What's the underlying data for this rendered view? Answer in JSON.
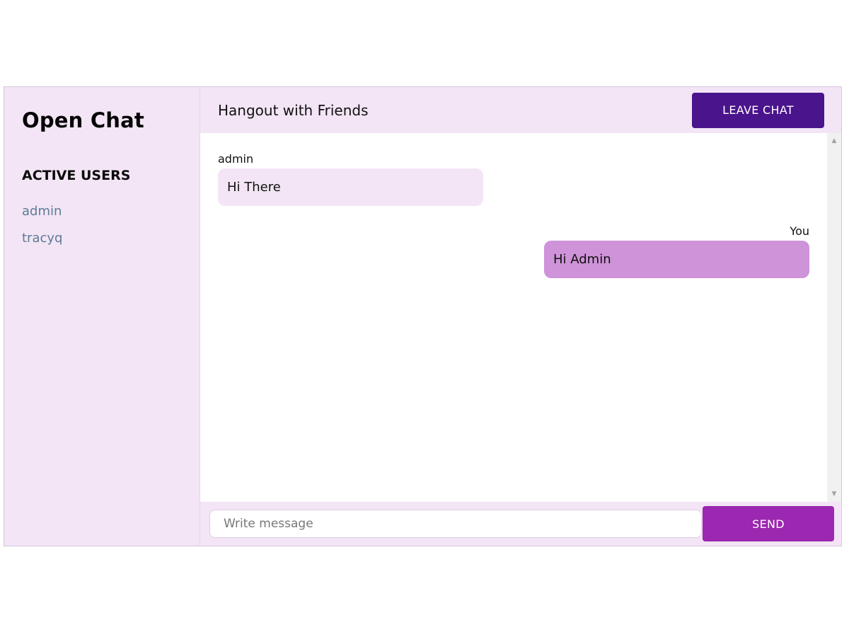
{
  "sidebar": {
    "brand": "Open Chat",
    "users_heading": "ACTIVE USERS",
    "users": [
      "admin",
      "tracyq"
    ]
  },
  "header": {
    "room_title": "Hangout with Friends",
    "leave_label": "LEAVE CHAT"
  },
  "messages": [
    {
      "sender": "admin",
      "text": "Hi There",
      "direction": "incoming"
    },
    {
      "sender": "You",
      "text": "Hi Admin",
      "direction": "outgoing"
    }
  ],
  "composer": {
    "placeholder": "Write message",
    "value": "",
    "send_label": "SEND"
  },
  "colors": {
    "panel_background": "#f3e5f5",
    "leave_button": "#4a148c",
    "send_button": "#9c27b0",
    "outgoing_bubble": "#ce93d8",
    "incoming_bubble": "#f3e5f5",
    "user_link": "#5e7a97"
  }
}
